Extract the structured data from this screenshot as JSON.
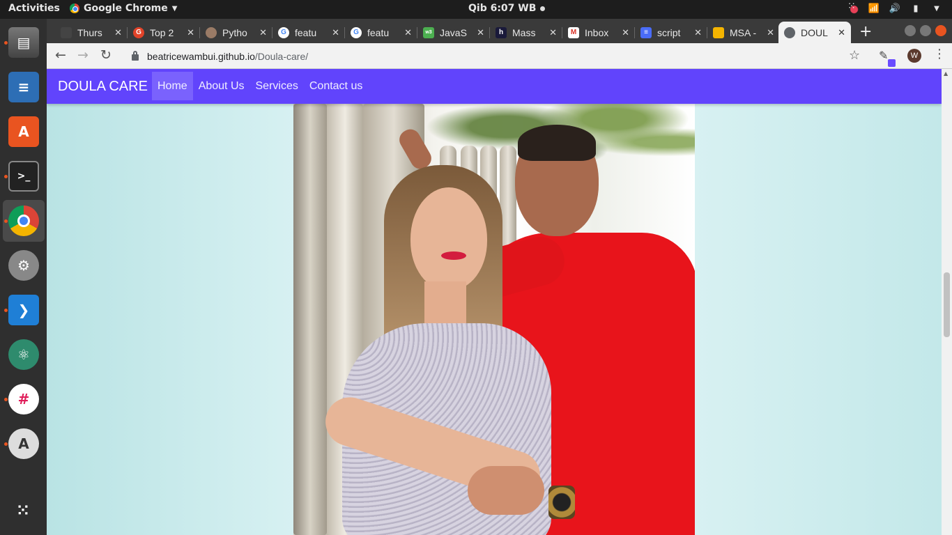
{
  "system_bar": {
    "activities": "Activities",
    "app_menu": "Google Chrome",
    "clock": "Qib  6:07 WB"
  },
  "dock": {
    "items": [
      "files",
      "libreoffice-writer",
      "ubuntu-software",
      "terminal",
      "google-chrome",
      "system-settings",
      "vscode",
      "atom",
      "slack",
      "software-updater",
      "show-applications"
    ]
  },
  "browser": {
    "tabs": [
      {
        "title": "Thurs",
        "icon": "github-icon"
      },
      {
        "title": "Top 2",
        "icon": "gitlab-icon"
      },
      {
        "title": "Pytho",
        "icon": "avatar-icon"
      },
      {
        "title": "featu",
        "icon": "google-icon"
      },
      {
        "title": "featu",
        "icon": "google-icon"
      },
      {
        "title": "JavaS",
        "icon": "w3schools-icon"
      },
      {
        "title": "Mass",
        "icon": "hackernoon-icon"
      },
      {
        "title": "Inbox",
        "icon": "gmail-icon"
      },
      {
        "title": "script",
        "icon": "docs-icon"
      },
      {
        "title": "MSA -",
        "icon": "slides-icon"
      },
      {
        "title": "DOUL",
        "icon": "globe-icon",
        "active": true
      }
    ],
    "url": {
      "host": "beatricewambui.github.io",
      "path": "/Doula-care/"
    },
    "profile_initial": "W"
  },
  "page": {
    "brand": "DOULA CARE",
    "nav": [
      {
        "label": "Home",
        "active": true
      },
      {
        "label": "About Us"
      },
      {
        "label": "Services"
      },
      {
        "label": "Contact us"
      }
    ],
    "colors": {
      "navbar": "#6144fc",
      "background": "#d7f1f2"
    }
  }
}
